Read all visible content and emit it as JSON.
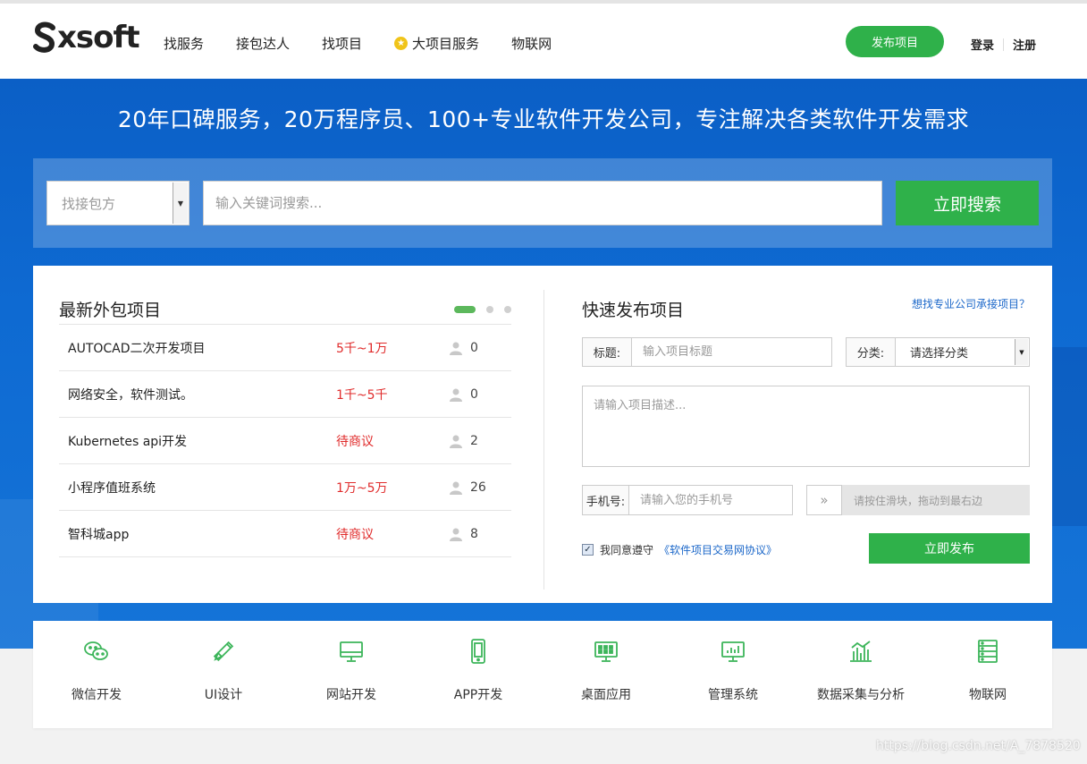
{
  "brand": {
    "logo_text": "xsoft",
    "accent": "#2fb14a",
    "hero_blue": "#0e6ad2"
  },
  "nav": {
    "items": [
      {
        "label": "找服务"
      },
      {
        "label": "接包达人"
      },
      {
        "label": "找项目"
      },
      {
        "label": "大项目服务",
        "icon": "star-badge-icon"
      },
      {
        "label": "物联网"
      }
    ],
    "publish_label": "发布项目",
    "login_label": "登录",
    "register_label": "注册"
  },
  "hero": {
    "title": "20年口碑服务，20万程序员、100+专业软件开发公司，专注解决各类软件开发需求"
  },
  "search": {
    "type_value": "找接包方",
    "placeholder": "输入关键词搜索...",
    "button_label": "立即搜索"
  },
  "latest": {
    "title": "最新外包项目",
    "projects": [
      {
        "name": "AUTOCAD二次开发项目",
        "price": "5千~1万",
        "bids": "0"
      },
      {
        "name": "网络安全，软件测试。",
        "price": "1千~5千",
        "bids": "0"
      },
      {
        "name": "Kubernetes api开发",
        "price": "待商议",
        "bids": "2"
      },
      {
        "name": "小程序值班系统",
        "price": "1万~5万",
        "bids": "26"
      },
      {
        "name": "智科城app",
        "price": "待商议",
        "bids": "8"
      }
    ]
  },
  "quick": {
    "title": "快速发布项目",
    "link": "想找专业公司承接项目？",
    "title_label": "标题:",
    "title_placeholder": "输入项目标题",
    "category_label": "分类:",
    "category_value": "请选择分类",
    "desc_placeholder": "请输入项目描述...",
    "phone_label": "手机号:",
    "phone_placeholder": "请输入您的手机号",
    "slider_handle": "»",
    "slider_text": "请按住滑块，拖动到最右边",
    "agree_text": "我同意遵守",
    "agree_link": "《软件项目交易网协议》",
    "agree_checked": true,
    "submit_label": "立即发布"
  },
  "categories": [
    {
      "label": "微信开发",
      "icon": "wechat-icon"
    },
    {
      "label": "UI设计",
      "icon": "design-tools-icon"
    },
    {
      "label": "网站开发",
      "icon": "monitor-icon"
    },
    {
      "label": "APP开发",
      "icon": "mobile-icon"
    },
    {
      "label": "桌面应用",
      "icon": "desktop-app-icon"
    },
    {
      "label": "管理系统",
      "icon": "chart-screen-icon"
    },
    {
      "label": "数据采集与分析",
      "icon": "bar-chart-icon"
    },
    {
      "label": "物联网",
      "icon": "server-list-icon"
    }
  ],
  "watermark": "https://blog.csdn.net/A_7878520"
}
